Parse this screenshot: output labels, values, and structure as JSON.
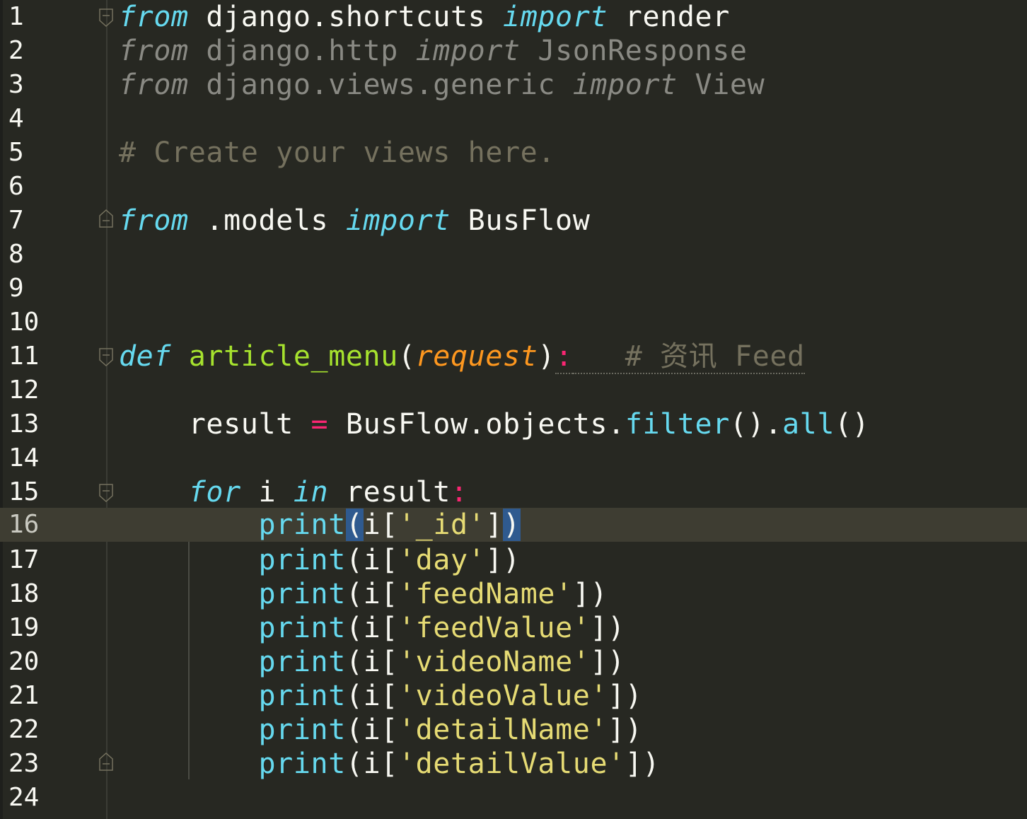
{
  "editor": {
    "language": "python",
    "current_line": 16,
    "lines": [
      {
        "n": "1"
      },
      {
        "n": "2"
      },
      {
        "n": "3"
      },
      {
        "n": "4"
      },
      {
        "n": "5"
      },
      {
        "n": "6"
      },
      {
        "n": "7"
      },
      {
        "n": "8"
      },
      {
        "n": "9"
      },
      {
        "n": "10"
      },
      {
        "n": "11"
      },
      {
        "n": "12"
      },
      {
        "n": "13"
      },
      {
        "n": "14"
      },
      {
        "n": "15"
      },
      {
        "n": "16"
      },
      {
        "n": "17"
      },
      {
        "n": "18"
      },
      {
        "n": "19"
      },
      {
        "n": "20"
      },
      {
        "n": "21"
      },
      {
        "n": "22"
      },
      {
        "n": "23"
      },
      {
        "n": "24"
      }
    ],
    "tokens": {
      "l1": [
        "from",
        " django.shortcuts ",
        "import",
        " render"
      ],
      "l2": [
        "from",
        " django.http ",
        "import",
        " JsonResponse"
      ],
      "l3": [
        "from",
        " django.views.generic ",
        "import",
        " View"
      ],
      "l5": [
        "# Create your views here."
      ],
      "l7": [
        "from",
        " .models ",
        "import",
        " BusFlow"
      ],
      "l11": [
        "def",
        " ",
        "article_menu",
        "(",
        "request",
        ")",
        ":",
        "   # 资讯 Feed"
      ],
      "l13": [
        "    result ",
        "=",
        " BusFlow.objects.",
        "filter",
        "().",
        "all",
        "()"
      ],
      "l15": [
        "    ",
        "for",
        " i ",
        "in",
        " result",
        ":"
      ],
      "l16": [
        "        ",
        "print",
        "(",
        "i[",
        "'_id'",
        "]",
        ")"
      ],
      "l17": [
        "        ",
        "print",
        "(i[",
        "'day'",
        "])"
      ],
      "l18": [
        "        ",
        "print",
        "(i[",
        "'feedName'",
        "])"
      ],
      "l19": [
        "        ",
        "print",
        "(i[",
        "'feedValue'",
        "])"
      ],
      "l20": [
        "        ",
        "print",
        "(i[",
        "'videoName'",
        "])"
      ],
      "l21": [
        "        ",
        "print",
        "(i[",
        "'videoValue'",
        "])"
      ],
      "l22": [
        "        ",
        "print",
        "(i[",
        "'detailName'",
        "])"
      ],
      "l23": [
        "        ",
        "print",
        "(i[",
        "'detailValue'",
        "])"
      ]
    },
    "colors": {
      "background": "#272822",
      "current_line": "#3e3d32",
      "keyword": "#66D9EF",
      "operator": "#F92672",
      "string": "#E6DB74",
      "function": "#A6E22E",
      "parameter": "#FD971F",
      "comment": "#75715E",
      "bracket_match": "#2f5a8f"
    }
  }
}
